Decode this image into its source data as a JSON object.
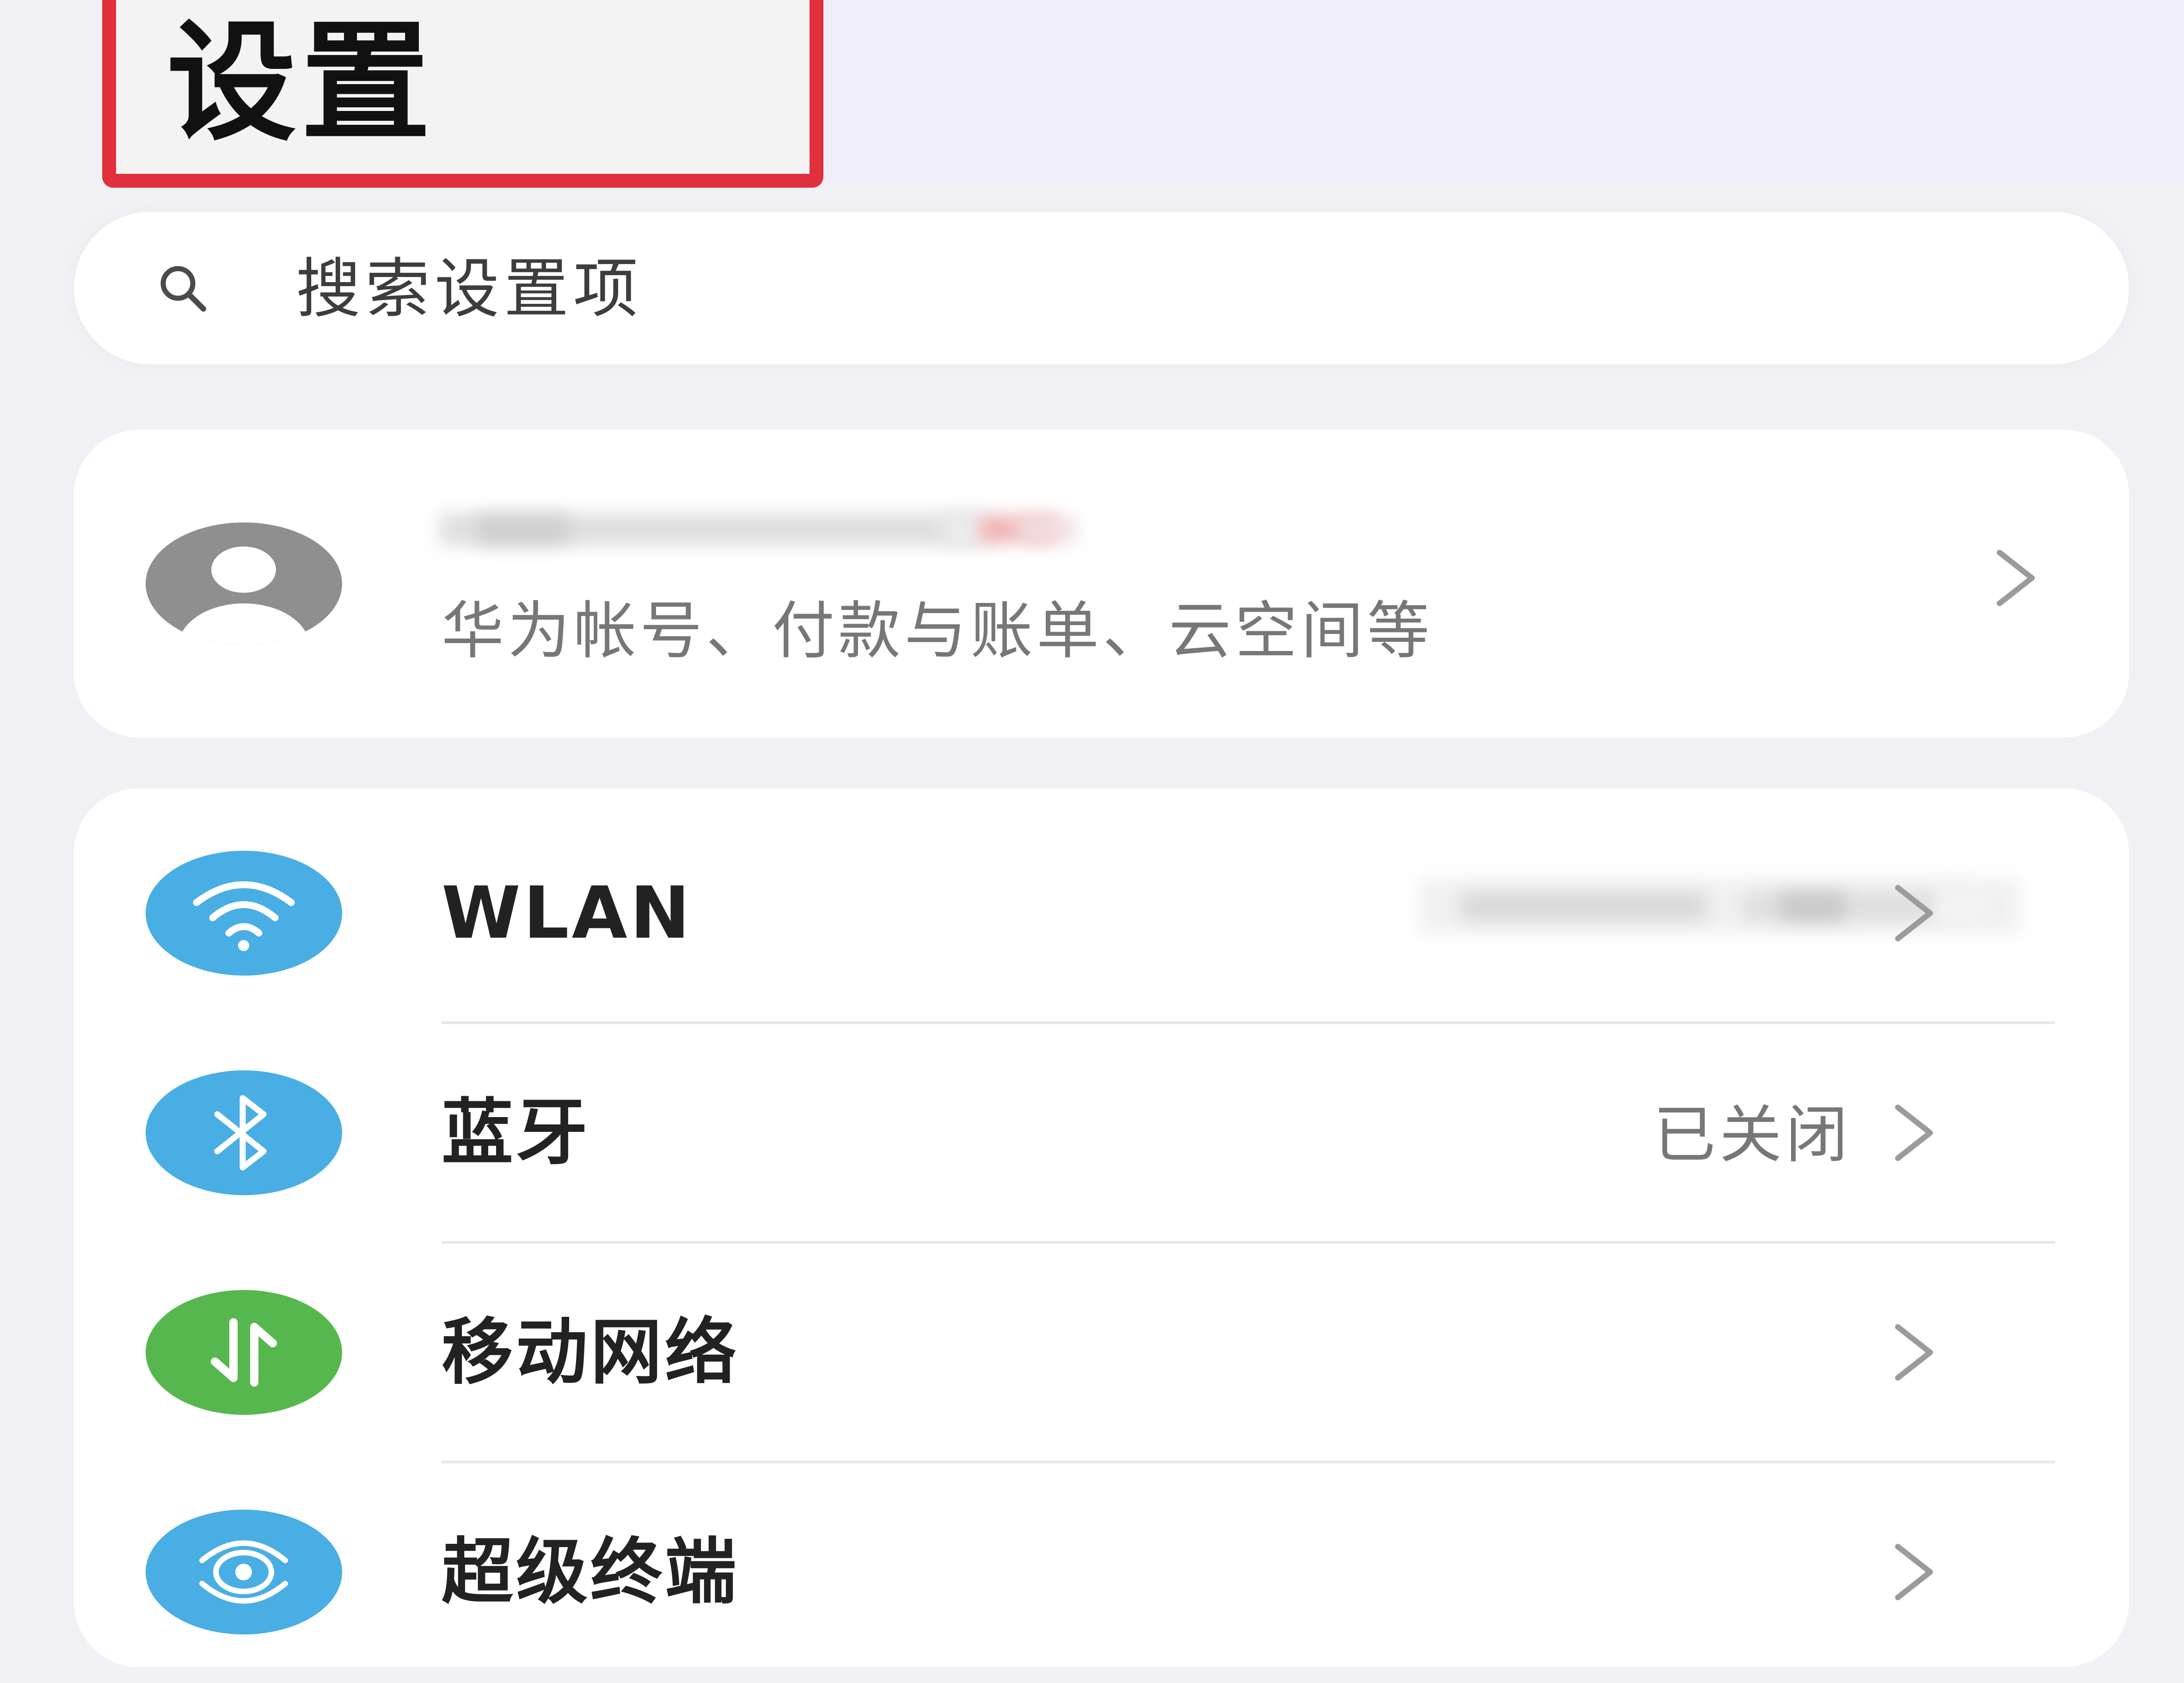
{
  "header": {
    "title": "设置"
  },
  "search": {
    "placeholder": "搜索设置项"
  },
  "account": {
    "subtitle": "华为帐号、付款与账单、云空间等"
  },
  "settings": {
    "items": [
      {
        "label": "WLAN",
        "status": "",
        "icon": "wifi-icon",
        "color": "#49aee3"
      },
      {
        "label": "蓝牙",
        "status": "已关闭",
        "icon": "bluetooth-icon",
        "color": "#49aee3"
      },
      {
        "label": "移动网络",
        "status": "",
        "icon": "mobile-data-icon",
        "color": "#57b74f"
      },
      {
        "label": "超级终端",
        "status": "",
        "icon": "super-device-icon",
        "color": "#49aee3"
      }
    ]
  },
  "colors": {
    "highlight_border": "#e0303e",
    "accent_blue": "#49aee3",
    "accent_green": "#57b74f",
    "avatar_gray": "#8f8f8f"
  }
}
